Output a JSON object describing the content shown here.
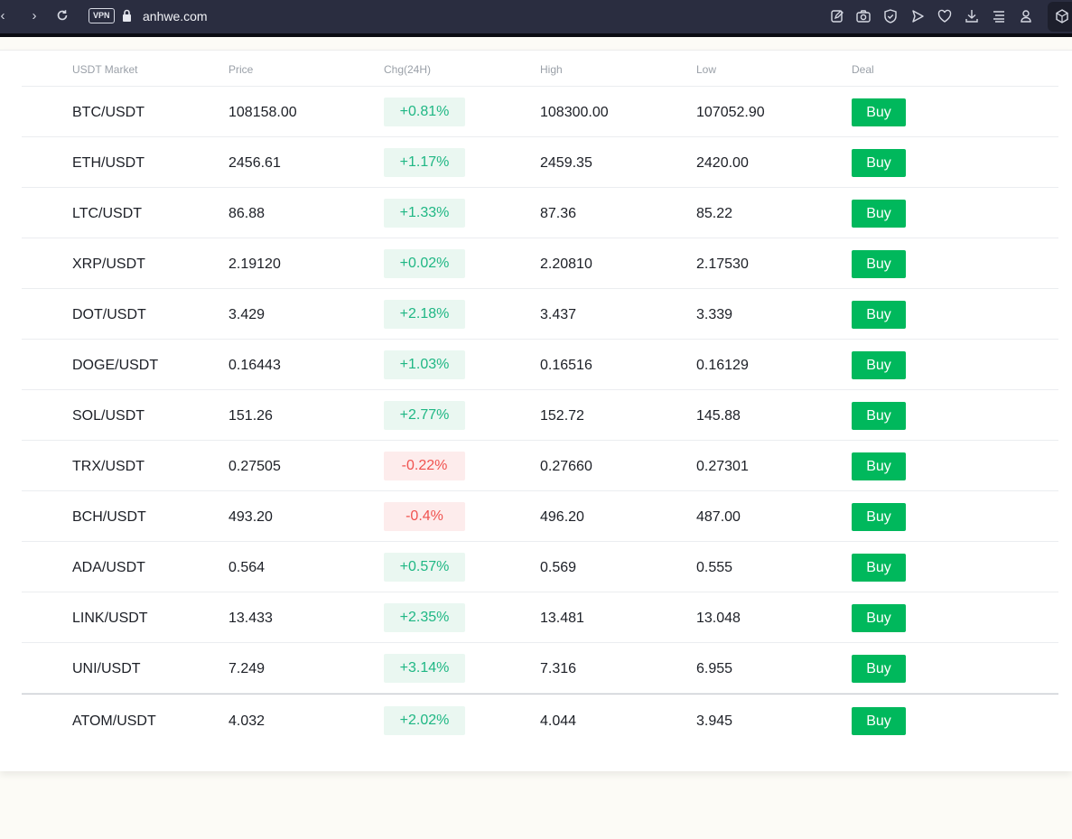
{
  "browser": {
    "url": "anhwe.com",
    "vpn_label": "VPN",
    "icons": [
      "back-icon",
      "forward-icon",
      "reload-icon",
      "lock-icon",
      "edit-icon",
      "camera-icon",
      "shield-icon",
      "send-icon",
      "heart-icon",
      "download-icon",
      "menu-icon",
      "profile-icon",
      "extension-icon"
    ]
  },
  "colors": {
    "up": "#1fb784",
    "down": "#f0524f",
    "buy": "#00b85c",
    "browser_bg": "#2a2d40",
    "page_bg": "#fcfbf6"
  },
  "market": {
    "headers": [
      "USDT Market",
      "Price",
      "Chg(24H)",
      "High",
      "Low",
      "Deal"
    ],
    "rows": [
      {
        "pair": "BTC/USDT",
        "price": "108158.00",
        "chg": "+0.81%",
        "dir": "up",
        "high": "108300.00",
        "low": "107052.90",
        "deal": "Buy"
      },
      {
        "pair": "ETH/USDT",
        "price": "2456.61",
        "chg": "+1.17%",
        "dir": "up",
        "high": "2459.35",
        "low": "2420.00",
        "deal": "Buy"
      },
      {
        "pair": "LTC/USDT",
        "price": "86.88",
        "chg": "+1.33%",
        "dir": "up",
        "high": "87.36",
        "low": "85.22",
        "deal": "Buy"
      },
      {
        "pair": "XRP/USDT",
        "price": "2.19120",
        "chg": "+0.02%",
        "dir": "up",
        "high": "2.20810",
        "low": "2.17530",
        "deal": "Buy"
      },
      {
        "pair": "DOT/USDT",
        "price": "3.429",
        "chg": "+2.18%",
        "dir": "up",
        "high": "3.437",
        "low": "3.339",
        "deal": "Buy"
      },
      {
        "pair": "DOGE/USDT",
        "price": "0.16443",
        "chg": "+1.03%",
        "dir": "up",
        "high": "0.16516",
        "low": "0.16129",
        "deal": "Buy"
      },
      {
        "pair": "SOL/USDT",
        "price": "151.26",
        "chg": "+2.77%",
        "dir": "up",
        "high": "152.72",
        "low": "145.88",
        "deal": "Buy"
      },
      {
        "pair": "TRX/USDT",
        "price": "0.27505",
        "chg": "-0.22%",
        "dir": "down",
        "high": "0.27660",
        "low": "0.27301",
        "deal": "Buy"
      },
      {
        "pair": "BCH/USDT",
        "price": "493.20",
        "chg": "-0.4%",
        "dir": "down",
        "high": "496.20",
        "low": "487.00",
        "deal": "Buy"
      },
      {
        "pair": "ADA/USDT",
        "price": "0.564",
        "chg": "+0.57%",
        "dir": "up",
        "high": "0.569",
        "low": "0.555",
        "deal": "Buy"
      },
      {
        "pair": "LINK/USDT",
        "price": "13.433",
        "chg": "+2.35%",
        "dir": "up",
        "high": "13.481",
        "low": "13.048",
        "deal": "Buy"
      },
      {
        "pair": "UNI/USDT",
        "price": "7.249",
        "chg": "+3.14%",
        "dir": "up",
        "high": "7.316",
        "low": "6.955",
        "deal": "Buy"
      },
      {
        "pair": "ATOM/USDT",
        "price": "4.032",
        "chg": "+2.02%",
        "dir": "up",
        "high": "4.044",
        "low": "3.945",
        "deal": "Buy"
      }
    ]
  }
}
